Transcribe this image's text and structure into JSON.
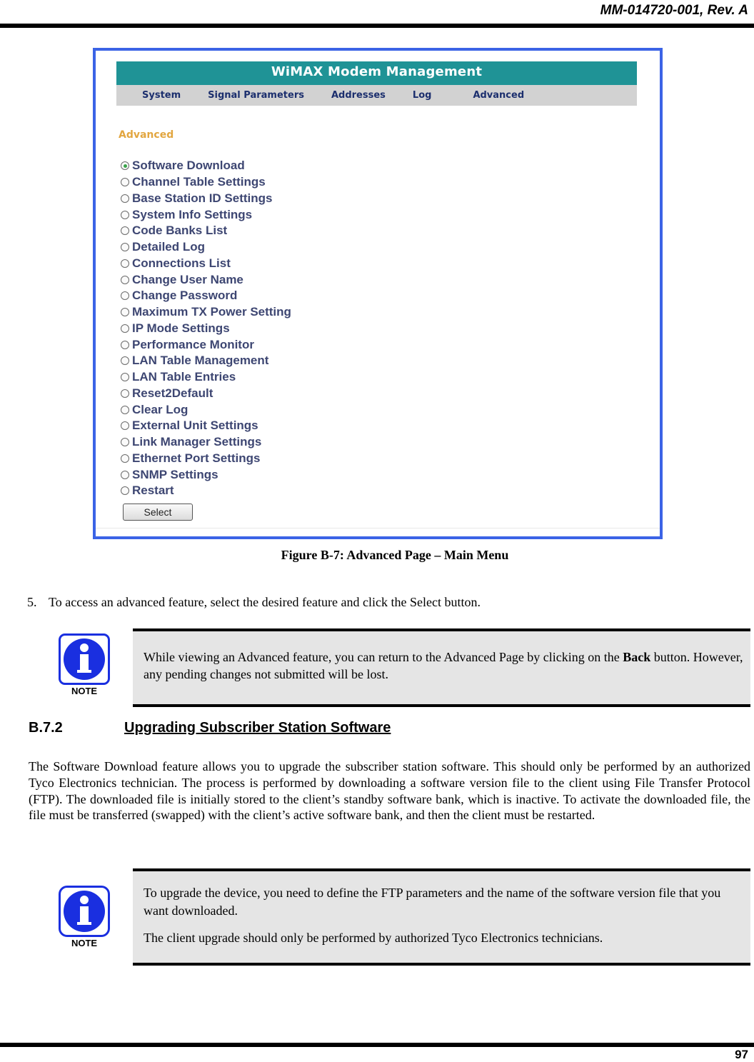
{
  "header": {
    "doc_id": "MM-014720-001, Rev. A"
  },
  "figure": {
    "app": {
      "title": "WiMAX Modem Management",
      "nav": [
        "System",
        "Signal Parameters",
        "Addresses",
        "Log",
        "Advanced"
      ],
      "section_heading": "Advanced",
      "options": [
        {
          "label": "Software Download",
          "selected": true
        },
        {
          "label": "Channel Table Settings",
          "selected": false
        },
        {
          "label": "Base Station ID Settings",
          "selected": false
        },
        {
          "label": "System Info Settings",
          "selected": false
        },
        {
          "label": "Code Banks List",
          "selected": false
        },
        {
          "label": "Detailed Log",
          "selected": false
        },
        {
          "label": "Connections List",
          "selected": false
        },
        {
          "label": "Change User Name",
          "selected": false
        },
        {
          "label": "Change Password",
          "selected": false
        },
        {
          "label": "Maximum TX Power Setting",
          "selected": false
        },
        {
          "label": "IP Mode Settings",
          "selected": false
        },
        {
          "label": "Performance Monitor",
          "selected": false
        },
        {
          "label": "LAN Table Management",
          "selected": false
        },
        {
          "label": "LAN Table Entries",
          "selected": false
        },
        {
          "label": "Reset2Default",
          "selected": false
        },
        {
          "label": "Clear Log",
          "selected": false
        },
        {
          "label": "External Unit Settings",
          "selected": false
        },
        {
          "label": "Link Manager Settings",
          "selected": false
        },
        {
          "label": "Ethernet Port Settings",
          "selected": false
        },
        {
          "label": "SNMP Settings",
          "selected": false
        },
        {
          "label": "Restart",
          "selected": false
        }
      ],
      "select_button": "Select",
      "colors": {
        "title_bar": "#1f9396",
        "nav_bar": "#d2d2d2",
        "heading": "#e2a640",
        "option_text": "#3d4672",
        "frame_border": "#3b63e6"
      }
    },
    "caption": "Figure B-7:  Advanced Page – Main Menu"
  },
  "step": {
    "number": "5.",
    "text": "To access an advanced feature, select the desired feature and click the Select button."
  },
  "note1": {
    "icon_label": "NOTE",
    "text_before": "While viewing an Advanced feature, you can return to the Advanced Page by clicking on the ",
    "bold": "Back",
    "text_after": " button.  However, any pending changes not submitted will be lost."
  },
  "section": {
    "number": "B.7.2",
    "title": "Upgrading Subscriber Station Software",
    "paragraph": "The Software Download feature allows you to upgrade the subscriber station software.  This should only be performed by an authorized Tyco Electronics technician.  The process is performed by downloading a software version file to the client using File Transfer Protocol (FTP).  The downloaded file is initially stored to the client’s standby software bank, which is inactive.  To activate the downloaded file, the file must be transferred (swapped) with the client’s active software bank, and then the client must be restarted."
  },
  "note2": {
    "icon_label": "NOTE",
    "para1": "To upgrade the device, you need to define the FTP parameters and the name of the software version file that you want downloaded.",
    "para2": "The client upgrade should only be performed by authorized Tyco Electronics technicians."
  },
  "footer": {
    "page_number": "97"
  }
}
